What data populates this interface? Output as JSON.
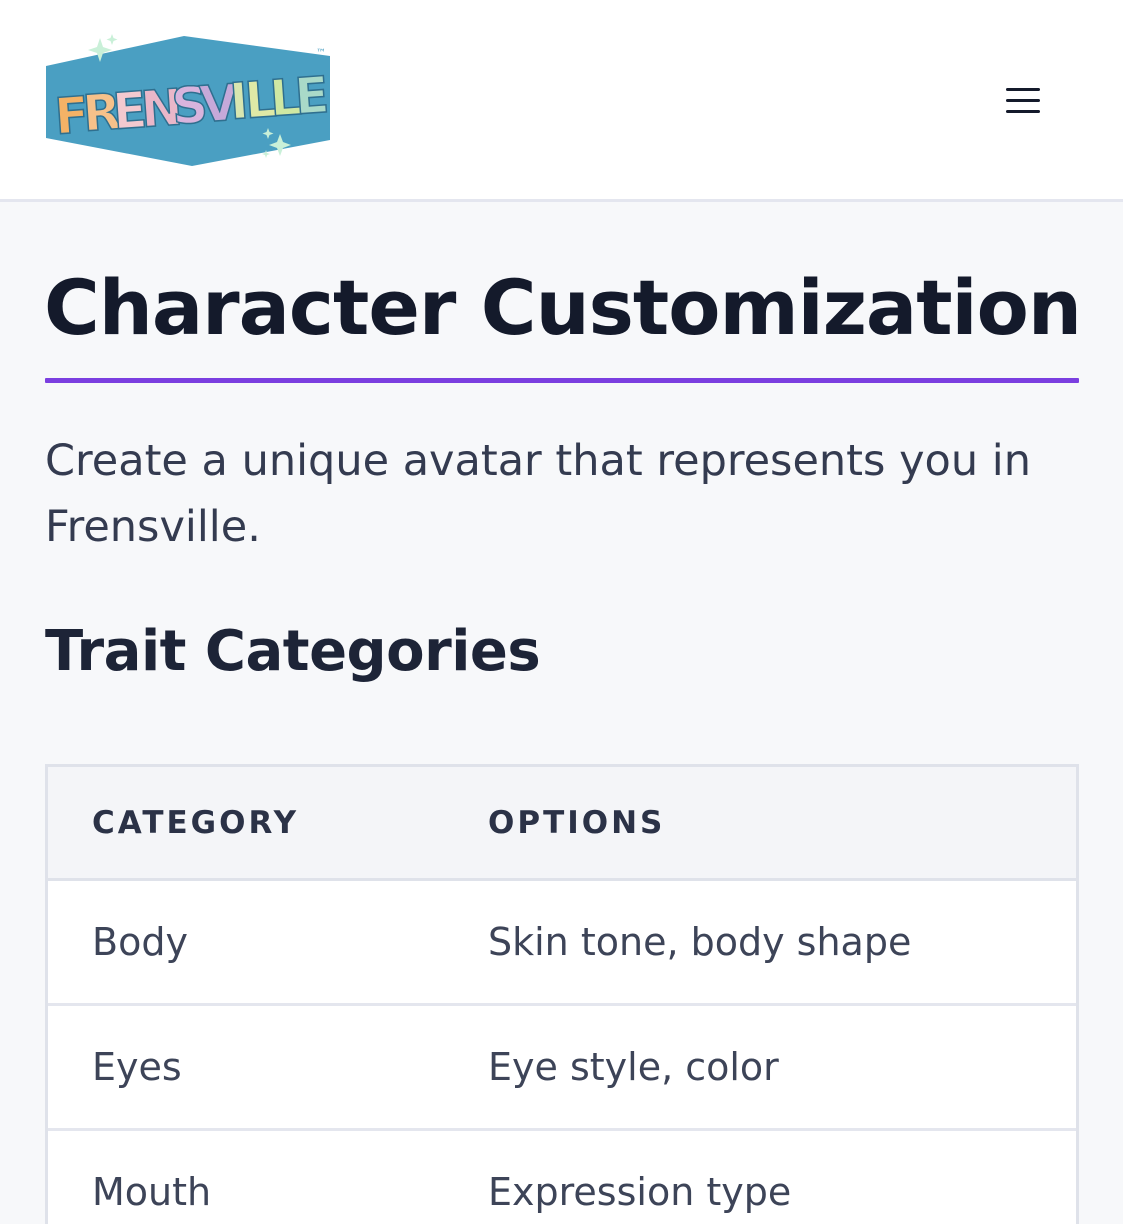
{
  "header": {
    "logo_text": "FRENSVILLE",
    "logo_tm": "™",
    "menu_icon": "hamburger-menu-icon"
  },
  "page": {
    "title": "Character Customization",
    "intro": "Create a unique avatar that represents you in Frensville.",
    "section_title": "Trait Categories"
  },
  "table": {
    "columns": [
      "CATEGORY",
      "OPTIONS"
    ],
    "rows": [
      {
        "category": "Body",
        "options": "Skin tone, body shape"
      },
      {
        "category": "Eyes",
        "options": "Eye style, color"
      },
      {
        "category": "Mouth",
        "options": "Expression type"
      }
    ]
  },
  "colors": {
    "accent": "#7b3fe0",
    "logo_badge": "#4a9fc2",
    "text_dark": "#141a2b",
    "text_body": "#343b50",
    "background": "#f7f8fa"
  }
}
